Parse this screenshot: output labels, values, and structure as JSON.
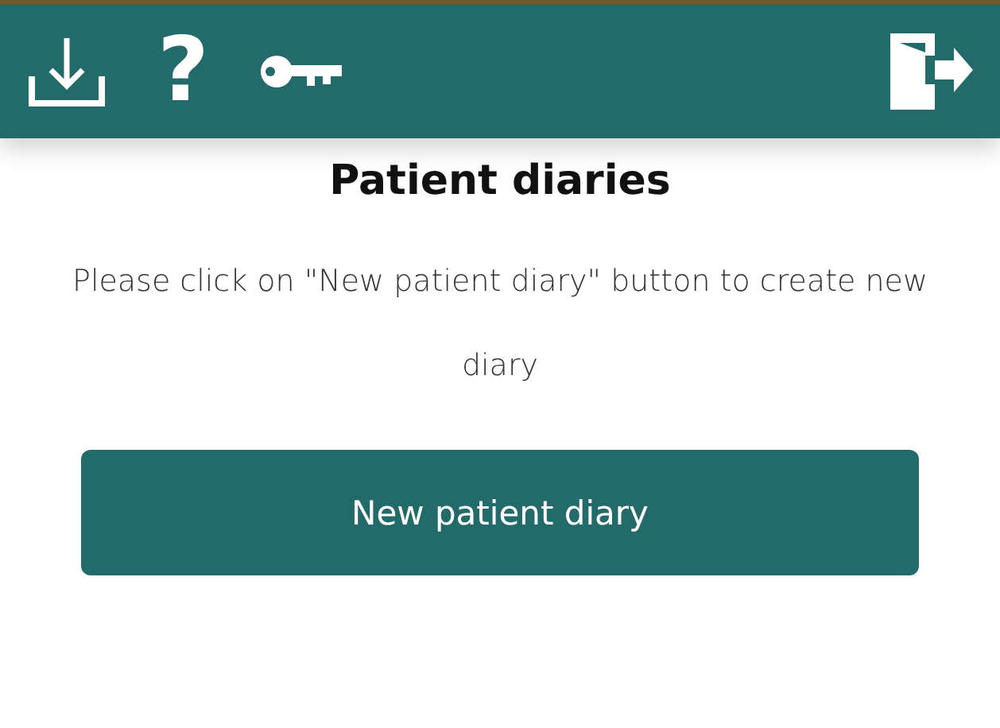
{
  "toolbar": [
    {
      "kind": "download"
    },
    {
      "kind": "help",
      "glyph": "?"
    },
    {
      "kind": "key"
    },
    {
      "kind": "exit"
    }
  ],
  "title": "Patient diaries",
  "message": "Please click on \"New patient diary\" button to create new diary",
  "button": "New patient diary"
}
